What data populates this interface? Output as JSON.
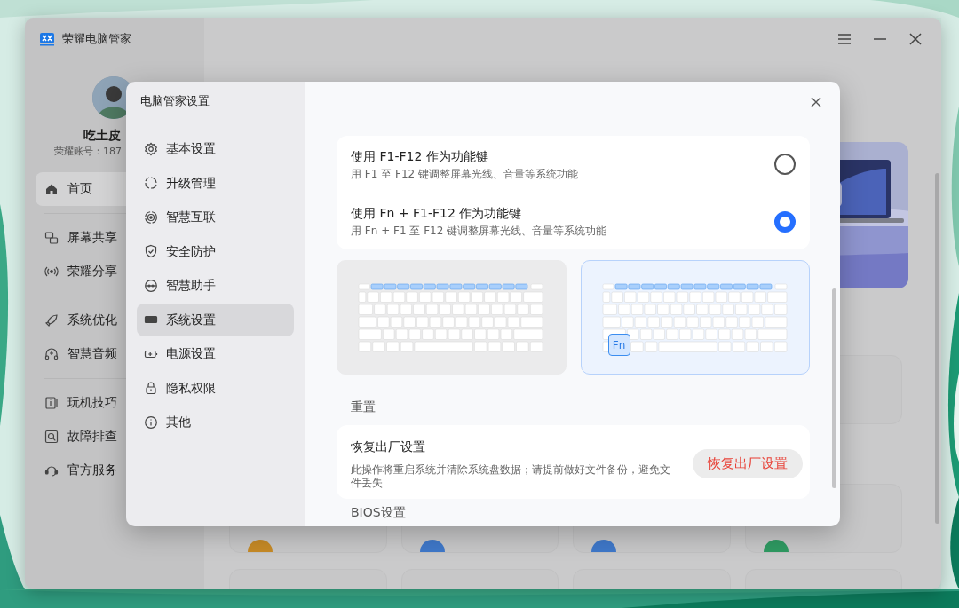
{
  "app": {
    "title": "荣耀电脑管家",
    "user": {
      "name": "吃土皮",
      "account": "荣耀账号：187"
    },
    "nav": [
      {
        "items": [
          {
            "label": "首页",
            "selected": true
          }
        ]
      },
      {
        "items": [
          {
            "label": "屏幕共享",
            "selected": false
          },
          {
            "label": "荣耀分享",
            "selected": false
          }
        ]
      },
      {
        "items": [
          {
            "label": "系统优化",
            "selected": false
          },
          {
            "label": "智慧音频",
            "selected": false
          }
        ]
      },
      {
        "items": [
          {
            "label": "玩机技巧",
            "selected": false
          },
          {
            "label": "故障排查",
            "selected": false
          },
          {
            "label": "官方服务",
            "selected": false
          }
        ]
      }
    ]
  },
  "dialog": {
    "title": "电脑管家设置",
    "menu": [
      {
        "label": "基本设置",
        "selected": false
      },
      {
        "label": "升级管理",
        "selected": false
      },
      {
        "label": "智慧互联",
        "selected": false
      },
      {
        "label": "安全防护",
        "selected": false
      },
      {
        "label": "智慧助手",
        "selected": false
      },
      {
        "label": "系统设置",
        "selected": true
      },
      {
        "label": "电源设置",
        "selected": false
      },
      {
        "label": "隐私权限",
        "selected": false
      },
      {
        "label": "其他",
        "selected": false
      }
    ],
    "options": [
      {
        "title": "使用 F1-F12 作为功能键",
        "description": "用 F1 至 F12 键调整屏幕光线、音量等系统功能",
        "selected": false
      },
      {
        "title": "使用 Fn + F1-F12 作为功能键",
        "description": "用 Fn + F1 至 F12 键调整屏幕光线、音量等系统功能",
        "selected": true
      }
    ],
    "keyboards": [
      {
        "selected": false
      },
      {
        "selected": true,
        "key_label": "Fn"
      }
    ],
    "reset": {
      "heading": "重置",
      "title": "恢复出厂设置",
      "description": "此操作将重启系统并清除系统盘数据；请提前做好文件备份，避免文件丢失",
      "button": "恢复出厂设置"
    },
    "next_heading": "BIOS设置"
  }
}
